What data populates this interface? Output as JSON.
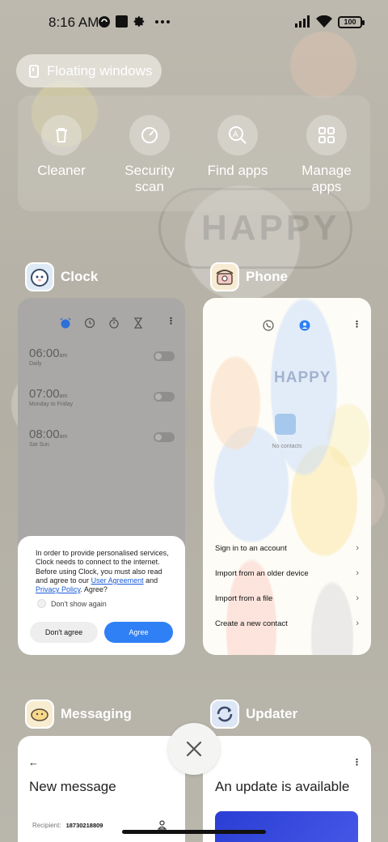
{
  "status_bar": {
    "time": "8:16 AM",
    "battery": "100",
    "left_icons": [
      "app-notification-icon",
      "square-app-icon",
      "gear-icon",
      "more-dots-icon"
    ],
    "right_icons": [
      "signal-icon",
      "wifi-icon",
      "battery-icon"
    ]
  },
  "floating_windows": {
    "label": "Floating windows"
  },
  "quick_actions": [
    {
      "label": "Cleaner",
      "icon": "trash-icon"
    },
    {
      "label": "Security scan",
      "icon": "shield-scan-icon"
    },
    {
      "label": "Find apps",
      "icon": "search-apps-icon"
    },
    {
      "label": "Manage apps",
      "icon": "grid-icon"
    }
  ],
  "apps": {
    "clock": {
      "name": "Clock",
      "tabs": [
        "alarm-icon",
        "clock-icon",
        "stopwatch-icon",
        "timer-icon"
      ],
      "alarms": [
        {
          "time": "06:00",
          "period": "am",
          "sub": "Daily"
        },
        {
          "time": "07:00",
          "period": "am",
          "sub": "Monday to Friday"
        },
        {
          "time": "08:00",
          "period": "am",
          "sub": "Sat Sun"
        }
      ],
      "dialog": {
        "text": "In order to provide personalised services, Clock needs to connect to the internet. Before using Clock, you must also read and agree to our",
        "link1": "User Agreement",
        "and": "and",
        "link2": "Privacy Policy",
        "tail": ". Agree?",
        "checkbox": "Don't show again",
        "disagree": "Don't agree",
        "agree": "Agree"
      }
    },
    "phone": {
      "name": "Phone",
      "no_contacts": "No contacts",
      "options": [
        "Sign in to an account",
        "Import from an older device",
        "Import from a file",
        "Create a new contact"
      ]
    },
    "messaging": {
      "name": "Messaging",
      "title": "New message",
      "recipient_label": "Recipient:",
      "recipient_value": "18730218809"
    },
    "updater": {
      "name": "Updater",
      "title": "An update is available"
    }
  },
  "colors": {
    "agree_button": "#2f80f5",
    "updater_banner": "#2a3ed4",
    "link": "#1a5ad8"
  }
}
